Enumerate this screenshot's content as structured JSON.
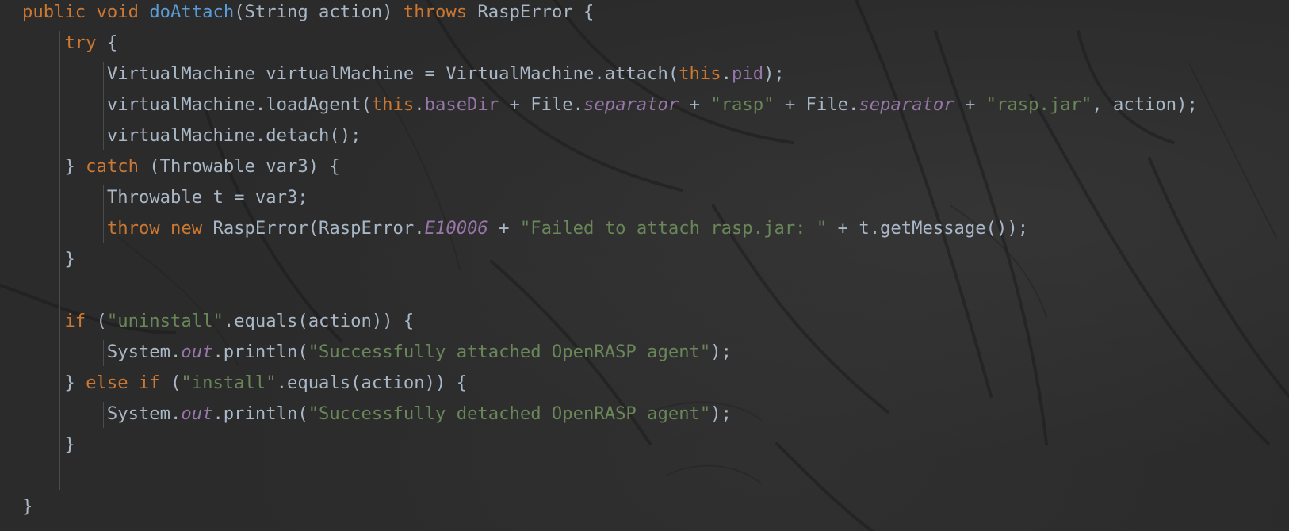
{
  "editor": {
    "language": "java",
    "theme": "dark",
    "colors": {
      "background": "#2b2b2b",
      "default_text": "#a9b7c6",
      "keyword": "#cc7832",
      "method_declaration": "#5c9cd6",
      "string": "#6a8759",
      "field": "#9876aa",
      "static_field": "#9876aa"
    },
    "lines": [
      {
        "tokens": [
          {
            "t": "public",
            "k": "kw"
          },
          {
            "t": " ",
            "k": "pl"
          },
          {
            "t": "void",
            "k": "kw"
          },
          {
            "t": " ",
            "k": "pl"
          },
          {
            "t": "doAttach",
            "k": "fn"
          },
          {
            "t": "(String action) ",
            "k": "pl"
          },
          {
            "t": "throws",
            "k": "kw"
          },
          {
            "t": " RaspError {",
            "k": "pl"
          }
        ]
      },
      {
        "tokens": [
          {
            "t": "    ",
            "k": "pl"
          },
          {
            "t": "try",
            "k": "kw"
          },
          {
            "t": " {",
            "k": "pl"
          }
        ]
      },
      {
        "tokens": [
          {
            "t": "        VirtualMachine virtualMachine = VirtualMachine.attach(",
            "k": "pl"
          },
          {
            "t": "this",
            "k": "kw"
          },
          {
            "t": ".",
            "k": "pl"
          },
          {
            "t": "pid",
            "k": "fld"
          },
          {
            "t": ");",
            "k": "pl"
          }
        ]
      },
      {
        "tokens": [
          {
            "t": "        virtualMachine.loadAgent(",
            "k": "pl"
          },
          {
            "t": "this",
            "k": "kw"
          },
          {
            "t": ".",
            "k": "pl"
          },
          {
            "t": "baseDir",
            "k": "fld"
          },
          {
            "t": " + File.",
            "k": "pl"
          },
          {
            "t": "separator",
            "k": "ist"
          },
          {
            "t": " + ",
            "k": "pl"
          },
          {
            "t": "\"rasp\"",
            "k": "str"
          },
          {
            "t": " + File.",
            "k": "pl"
          },
          {
            "t": "separator",
            "k": "ist"
          },
          {
            "t": " + ",
            "k": "pl"
          },
          {
            "t": "\"rasp.jar\"",
            "k": "str"
          },
          {
            "t": ", action);",
            "k": "pl"
          }
        ]
      },
      {
        "tokens": [
          {
            "t": "        virtualMachine.detach();",
            "k": "pl"
          }
        ]
      },
      {
        "tokens": [
          {
            "t": "    } ",
            "k": "pl"
          },
          {
            "t": "catch",
            "k": "kw"
          },
          {
            "t": " (Throwable var3) {",
            "k": "pl"
          }
        ]
      },
      {
        "tokens": [
          {
            "t": "        Throwable t = var3;",
            "k": "pl"
          }
        ]
      },
      {
        "tokens": [
          {
            "t": "        ",
            "k": "pl"
          },
          {
            "t": "throw",
            "k": "kw"
          },
          {
            "t": " ",
            "k": "pl"
          },
          {
            "t": "new",
            "k": "kw"
          },
          {
            "t": " RaspError(RaspError.",
            "k": "pl"
          },
          {
            "t": "E10006",
            "k": "ist"
          },
          {
            "t": " + ",
            "k": "pl"
          },
          {
            "t": "\"Failed to attach rasp.jar: \"",
            "k": "str"
          },
          {
            "t": " + t.getMessage());",
            "k": "pl"
          }
        ]
      },
      {
        "tokens": [
          {
            "t": "    }",
            "k": "pl"
          }
        ]
      },
      {
        "tokens": []
      },
      {
        "tokens": [
          {
            "t": "    ",
            "k": "pl"
          },
          {
            "t": "if",
            "k": "kw"
          },
          {
            "t": " (",
            "k": "pl"
          },
          {
            "t": "\"uninstall\"",
            "k": "str"
          },
          {
            "t": ".equals(action)) {",
            "k": "pl"
          }
        ]
      },
      {
        "tokens": [
          {
            "t": "        System.",
            "k": "pl"
          },
          {
            "t": "out",
            "k": "ist"
          },
          {
            "t": ".println(",
            "k": "pl"
          },
          {
            "t": "\"Successfully attached OpenRASP agent\"",
            "k": "str"
          },
          {
            "t": ");",
            "k": "pl"
          }
        ]
      },
      {
        "tokens": [
          {
            "t": "    } ",
            "k": "pl"
          },
          {
            "t": "else",
            "k": "kw"
          },
          {
            "t": " ",
            "k": "pl"
          },
          {
            "t": "if",
            "k": "kw"
          },
          {
            "t": " (",
            "k": "pl"
          },
          {
            "t": "\"install\"",
            "k": "str"
          },
          {
            "t": ".equals(action)) {",
            "k": "pl"
          }
        ]
      },
      {
        "tokens": [
          {
            "t": "        System.",
            "k": "pl"
          },
          {
            "t": "out",
            "k": "ist"
          },
          {
            "t": ".println(",
            "k": "pl"
          },
          {
            "t": "\"Successfully detached OpenRASP agent\"",
            "k": "str"
          },
          {
            "t": ");",
            "k": "pl"
          }
        ]
      },
      {
        "tokens": [
          {
            "t": "    }",
            "k": "pl"
          }
        ]
      },
      {
        "tokens": []
      },
      {
        "tokens": [
          {
            "t": "}",
            "k": "pl"
          }
        ]
      }
    ]
  }
}
